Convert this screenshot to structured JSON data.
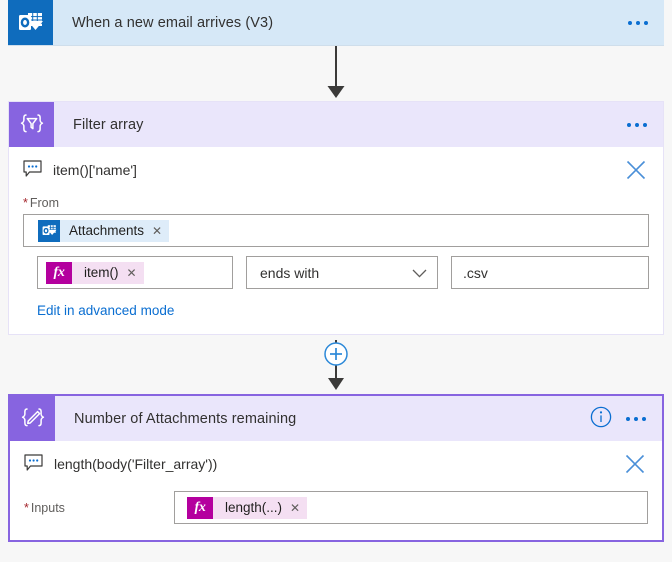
{
  "trigger": {
    "title": "When a new email arrives (V3)",
    "icon": "outlook-icon",
    "menu_icon": "ellipsis-icon",
    "header_color": "#d6e8f7",
    "icon_color": "#0f6cbd"
  },
  "filter_action": {
    "title": "Filter array",
    "icon": "filter-braces-icon",
    "menu_icon": "ellipsis-icon",
    "header_color": "#eae6fb",
    "icon_color": "#8764e0",
    "comment": {
      "icon": "comment-icon",
      "text": "item()['name']",
      "close_icon": "close-icon"
    },
    "from": {
      "label": "From",
      "required": true,
      "token": {
        "icon": "outlook-icon",
        "text": "Attachments",
        "remove_icon": "remove-token-icon"
      }
    },
    "condition": {
      "left": {
        "fx_label": "fx",
        "text": "item()",
        "remove_icon": "remove-token-icon"
      },
      "operator": "ends with",
      "operator_chevron": "chevron-down-icon",
      "value": ".csv"
    },
    "advanced_link": "Edit in advanced mode"
  },
  "connectors": {
    "plus_icon": "add-step-icon",
    "arrow_icon": "arrow-down-icon"
  },
  "compose_action": {
    "title": "Number of Attachments remaining",
    "icon": "compose-braces-icon",
    "info_icon": "info-icon",
    "menu_icon": "ellipsis-icon",
    "header_color": "#eae6fb",
    "icon_color": "#8764e0",
    "selected_border": "#8764e0",
    "comment": {
      "icon": "comment-icon",
      "text": "length(body('Filter_array'))",
      "close_icon": "close-icon"
    },
    "inputs": {
      "label": "Inputs",
      "required": true,
      "token": {
        "fx_label": "fx",
        "text": "length(...)",
        "remove_icon": "remove-token-icon"
      }
    }
  }
}
